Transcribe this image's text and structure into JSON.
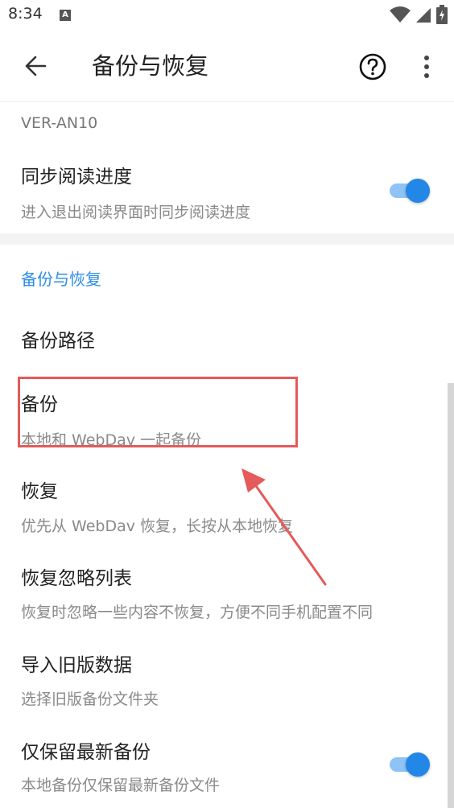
{
  "status_bar": {
    "time": "8:34",
    "notification_icon": "A"
  },
  "app_bar": {
    "title": "备份与恢复",
    "back_icon": "arrow-left-icon",
    "help_icon": "question-circle-icon",
    "more_icon": "more-vertical-icon"
  },
  "device": {
    "name": "VER-AN10"
  },
  "sync_reading": {
    "title": "同步阅读进度",
    "summary": "进入退出阅读界面时同步阅读进度",
    "enabled": true
  },
  "section": {
    "header": "备份与恢复"
  },
  "items": {
    "backup_path": {
      "title": "备份路径"
    },
    "backup": {
      "title": "备份",
      "summary": "本地和 WebDav 一起备份"
    },
    "restore": {
      "title": "恢复",
      "summary": "优先从 WebDav 恢复，长按从本地恢复"
    },
    "restore_ignore": {
      "title": "恢复忽略列表",
      "summary": "恢复时忽略一些内容不恢复，方便不同手机配置不同"
    },
    "import_old": {
      "title": "导入旧版数据",
      "summary": "选择旧版备份文件夹"
    },
    "keep_latest": {
      "title": "仅保留最新备份",
      "summary": "本地备份仅保留最新备份文件",
      "enabled": true
    }
  },
  "colors": {
    "accent": "#2387e8",
    "section_header": "#2f8de4",
    "highlight": "#e55a5a"
  }
}
